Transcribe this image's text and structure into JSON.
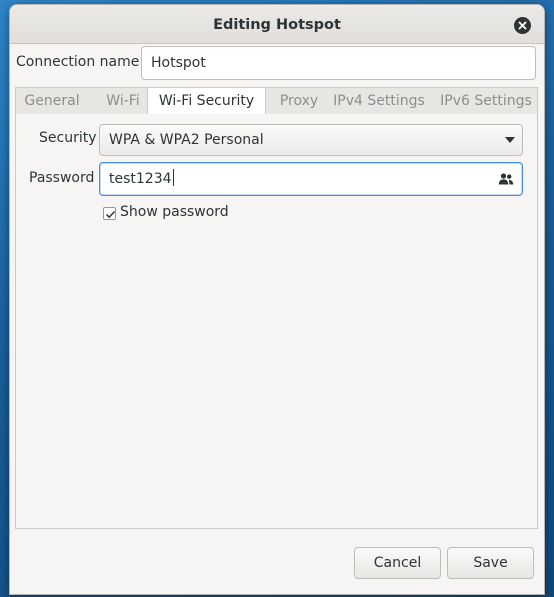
{
  "window": {
    "title": "Editing Hotspot"
  },
  "connection": {
    "label": "Connection name",
    "value": "Hotspot"
  },
  "tabs": [
    {
      "label": "General",
      "active": false
    },
    {
      "label": "Wi-Fi",
      "active": false
    },
    {
      "label": "Wi-Fi Security",
      "active": true
    },
    {
      "label": "Proxy",
      "active": false
    },
    {
      "label": "IPv4 Settings",
      "active": false
    },
    {
      "label": "IPv6 Settings",
      "active": false
    }
  ],
  "security": {
    "label": "Security",
    "selected": "WPA & WPA2 Personal",
    "icon": "chevron-down-icon"
  },
  "password": {
    "label": "Password",
    "value": "test1234",
    "icon": "people-icon"
  },
  "show_password": {
    "label": "Show password",
    "checked": true
  },
  "actions": {
    "cancel_label": "Cancel",
    "save_label": "Save"
  },
  "colors": {
    "focus": "#4a90d9",
    "window_bg": "#f6f5f4",
    "desktop": "#1e6aa8"
  }
}
